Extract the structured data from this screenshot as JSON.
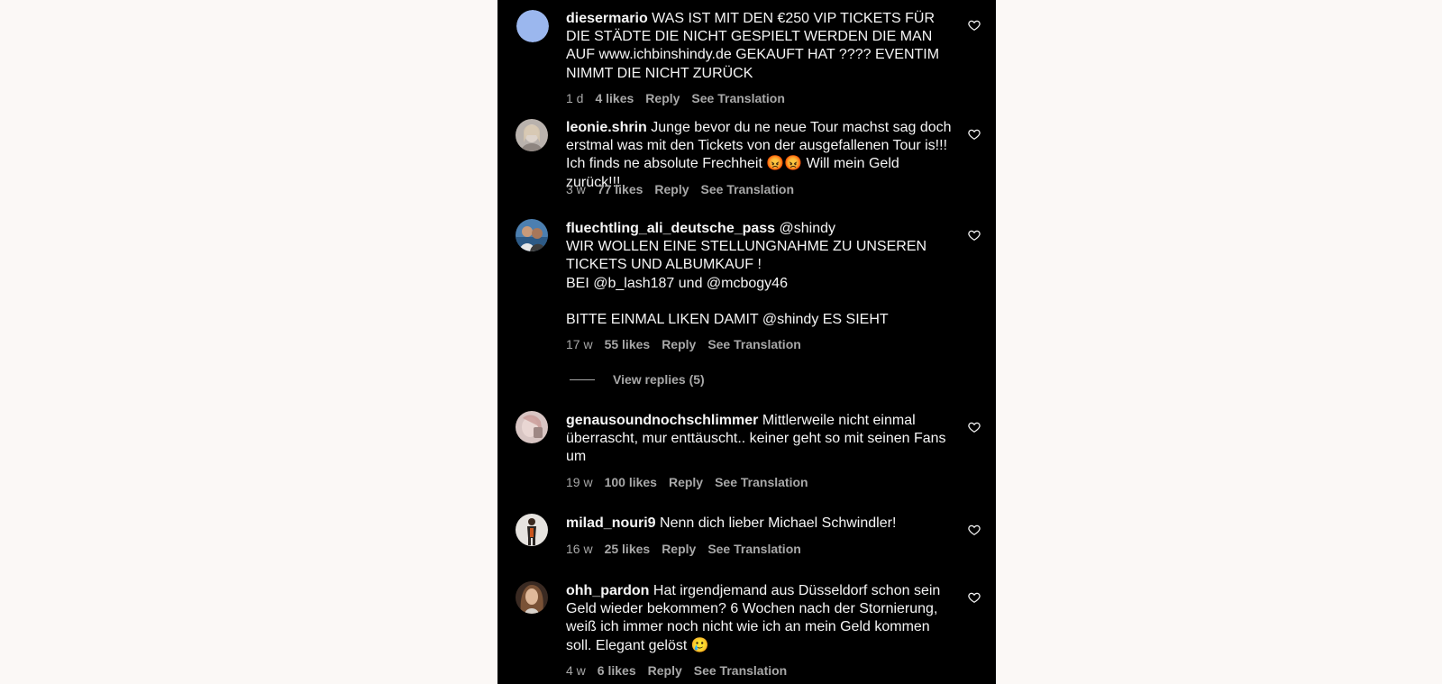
{
  "colors": {
    "panel_bg": "#000000",
    "page_bg": "#fbf8f6",
    "text": "#f5f5f5",
    "meta": "#a8a8a8"
  },
  "comments": [
    {
      "user": "diesermario",
      "text": "WAS IST MIT DEN €250 VIP TICKETS FÜR DIE STÄDTE DIE NICHT GESPIELT WERDEN DIE MAN AUF www.ichbinshindy.de GEKAUFT HAT ???? EVENTIM NIMMT DIE NICHT ZURÜCK",
      "time": "1 d",
      "likes": "4 likes",
      "reply": "Reply",
      "translate": "See Translation",
      "avatar": "solid-blue"
    },
    {
      "user": "leonie.shrin",
      "text": "Junge bevor du ne neue Tour machst sag doch erstmal was mit den Tickets von der ausgefallenen Tour is!!! Ich finds ne absolute Frechheit 😡😡 Will mein Geld zurück!!!",
      "time": "3 w",
      "likes": "77 likes",
      "reply": "Reply",
      "translate": "See Translation",
      "avatar": "photo"
    },
    {
      "user": "fluechtling_ali_deutsche_pass",
      "text": "@shindy\nWIR WOLLEN EINE STELLUNGNAHME ZU UNSEREN TICKETS UND ALBUMKAUF !\nBEI @b_lash187 und @mcbogy46\n\nBITTE EINMAL LIKEN DAMIT @shindy ES SIEHT",
      "time": "17 w",
      "likes": "55 likes",
      "reply": "Reply",
      "translate": "See Translation",
      "avatar": "photo"
    },
    {
      "user": "genausoundnochschlimmer",
      "text": "Mittlerweile nicht einmal überrascht, mur enttäuscht.. keiner geht so mit seinen Fans um",
      "time": "19 w",
      "likes": "100 likes",
      "reply": "Reply",
      "translate": "See Translation",
      "avatar": "photo"
    },
    {
      "user": "milad_nouri9",
      "text": "Nenn dich lieber Michael Schwindler!",
      "time": "16 w",
      "likes": "25 likes",
      "reply": "Reply",
      "translate": "See Translation",
      "avatar": "photo"
    },
    {
      "user": "ohh_pardon",
      "text": "Hat irgendjemand aus Düsseldorf schon sein Geld wieder bekommen? 6 Wochen nach der Stornierung, weiß ich immer noch nicht wie ich an mein Geld kommen soll. Elegant gelöst 🥲",
      "time": "4 w",
      "likes": "6 likes",
      "reply": "Reply",
      "translate": "See Translation",
      "avatar": "photo"
    }
  ],
  "view_replies": "View replies (5)"
}
